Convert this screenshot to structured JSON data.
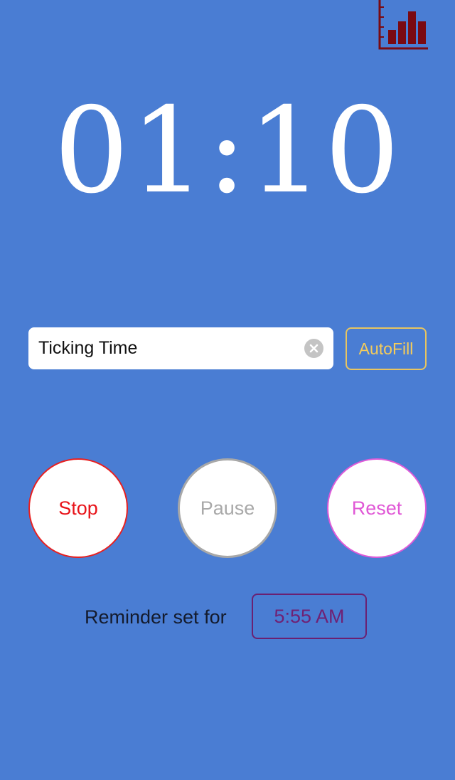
{
  "toolbar": {
    "stats_icon": "bar-chart-icon",
    "stats_color": "#7a0a12"
  },
  "timer": {
    "display": "01:10"
  },
  "task": {
    "name_value": "Ticking Time",
    "clear_icon": "clear-circle-icon",
    "autofill_label": "AutoFill"
  },
  "controls": {
    "stop_label": "Stop",
    "pause_label": "Pause",
    "reset_label": "Reset"
  },
  "reminder": {
    "label": "Reminder set for",
    "time": "5:55 AM"
  },
  "colors": {
    "background": "#4a7dd3",
    "autofill_accent": "#f5cc5a",
    "stop": "#e8141a",
    "pause": "#a9a9a9",
    "reset": "#e058d6",
    "reminder_time": "#6f2174"
  }
}
